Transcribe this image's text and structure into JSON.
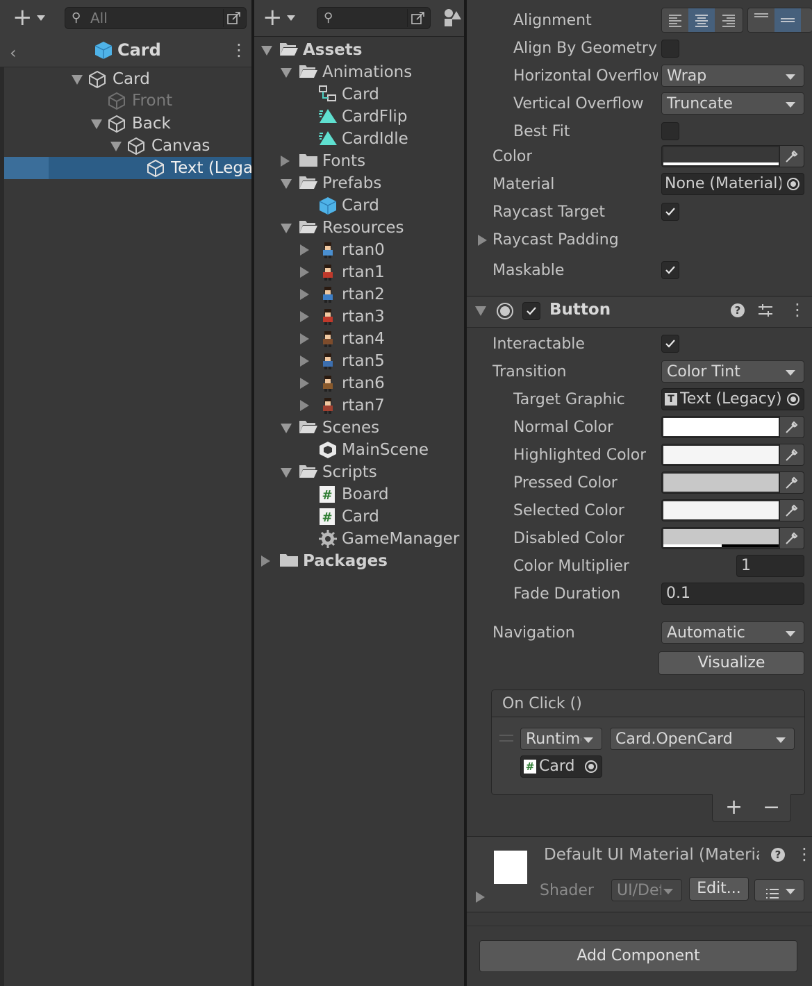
{
  "hierarchy": {
    "search_placeholder": "All",
    "breadcrumb": "Card",
    "items": [
      {
        "label": "Card",
        "enabled": true
      },
      {
        "label": "Front",
        "enabled": false
      },
      {
        "label": "Back",
        "enabled": true
      },
      {
        "label": "Canvas",
        "enabled": true
      },
      {
        "label": "Text (Legacy)",
        "enabled": true,
        "selected": true
      }
    ]
  },
  "project": {
    "items": [
      {
        "label": "Assets",
        "type": "folder"
      },
      {
        "label": "Animations",
        "type": "folder"
      },
      {
        "label": "Card",
        "type": "animator-controller"
      },
      {
        "label": "CardFlip",
        "type": "animation-clip"
      },
      {
        "label": "CardIdle",
        "type": "animation-clip"
      },
      {
        "label": "Fonts",
        "type": "folder"
      },
      {
        "label": "Prefabs",
        "type": "folder"
      },
      {
        "label": "Card",
        "type": "prefab"
      },
      {
        "label": "Resources",
        "type": "folder"
      },
      {
        "label": "rtan0",
        "type": "sprite"
      },
      {
        "label": "rtan1",
        "type": "sprite"
      },
      {
        "label": "rtan2",
        "type": "sprite"
      },
      {
        "label": "rtan3",
        "type": "sprite"
      },
      {
        "label": "rtan4",
        "type": "sprite"
      },
      {
        "label": "rtan5",
        "type": "sprite"
      },
      {
        "label": "rtan6",
        "type": "sprite"
      },
      {
        "label": "rtan7",
        "type": "sprite"
      },
      {
        "label": "Scenes",
        "type": "folder"
      },
      {
        "label": "MainScene",
        "type": "scene"
      },
      {
        "label": "Scripts",
        "type": "folder"
      },
      {
        "label": "Board",
        "type": "script"
      },
      {
        "label": "Card",
        "type": "script"
      },
      {
        "label": "GameManager",
        "type": "script-manager"
      },
      {
        "label": "Packages",
        "type": "folder"
      }
    ]
  },
  "inspector": {
    "text": {
      "alignment_label": "Alignment",
      "align_by_geometry_label": "Align By Geometry",
      "horizontal_overflow_label": "Horizontal Overflow",
      "horizontal_overflow_value": "Wrap",
      "vertical_overflow_label": "Vertical Overflow",
      "vertical_overflow_value": "Truncate",
      "best_fit_label": "Best Fit",
      "color_label": "Color",
      "material_label": "Material",
      "material_value": "None (Material)",
      "raycast_target_label": "Raycast Target",
      "raycast_padding_label": "Raycast Padding",
      "maskable_label": "Maskable"
    },
    "button": {
      "title": "Button",
      "interactable_label": "Interactable",
      "transition_label": "Transition",
      "transition_value": "Color Tint",
      "target_graphic_label": "Target Graphic",
      "target_graphic_value": "Text (Legacy)",
      "normal_color_label": "Normal Color",
      "highlighted_color_label": "Highlighted Color",
      "pressed_color_label": "Pressed Color",
      "selected_color_label": "Selected Color",
      "disabled_color_label": "Disabled Color",
      "color_multiplier_label": "Color Multiplier",
      "color_multiplier_value": "1",
      "fade_duration_label": "Fade Duration",
      "fade_duration_value": "0.1",
      "navigation_label": "Navigation",
      "navigation_value": "Automatic",
      "visualize_label": "Visualize",
      "on_click_label": "On Click ()",
      "runtime_value": "Runtime Only",
      "function_value": "Card.OpenCard",
      "target_object": "Card",
      "plus": "+",
      "minus": "−"
    },
    "material_section": {
      "title": "Default UI Material (Material)",
      "shader_label": "Shader",
      "shader_value": "UI/Default",
      "edit_label": "Edit..."
    },
    "add_component_label": "Add Component",
    "colors": {
      "normal": "#FFFFFF",
      "highlighted": "#F5F5F5",
      "pressed": "#C8C8C8",
      "selected": "#F5F5F5",
      "disabled": "#C8C8C8"
    }
  }
}
